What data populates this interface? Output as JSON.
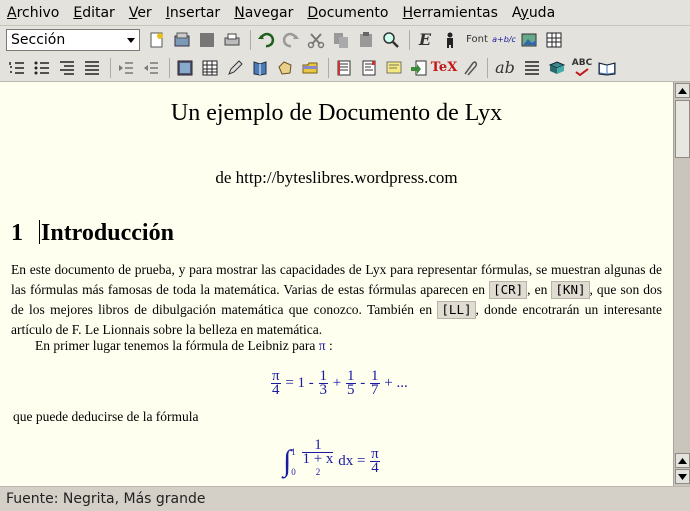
{
  "menu": [
    {
      "pre": "",
      "u": "A",
      "post": "rchivo"
    },
    {
      "pre": "",
      "u": "E",
      "post": "ditar"
    },
    {
      "pre": "",
      "u": "V",
      "post": "er"
    },
    {
      "pre": "",
      "u": "I",
      "post": "nsertar"
    },
    {
      "pre": "",
      "u": "N",
      "post": "avegar"
    },
    {
      "pre": "",
      "u": "D",
      "post": "ocumento"
    },
    {
      "pre": "",
      "u": "H",
      "post": "erramientas"
    },
    {
      "pre": "A",
      "u": "y",
      "post": "uda"
    }
  ],
  "toolbar": {
    "style_select": "Sección",
    "font_label": "Font",
    "math_label": "a+b/c",
    "tex_label": "TeX",
    "ab_label": "ab",
    "abc_label": "ABC"
  },
  "document": {
    "title": "Un ejemplo de Documento de Lyx",
    "author": "de http://byteslibres.wordpress.com",
    "section_number": "1",
    "section_title": "Introducción",
    "para1_a": "En este documento de prueba, y para mostrar las capacidades de Lyx para representar fórmulas, se muestran algunas de las fórmulas más famosas de toda la matemática. Varias de estas fórmulas aparecen en ",
    "cite_cr": "[CR]",
    "para1_b": ", en ",
    "cite_kn": "[KN]",
    "para1_c": ", que son dos de los mejores libros de dibulgación matemática que conozco. También en ",
    "cite_ll": "[LL]",
    "para1_d": ", donde encotrarán un interesante artículo de F. Le Lionnais sobre la belleza en matemática.",
    "para2": "En primer lugar tenemos la fórmula de Leibniz para ",
    "pi": "π",
    "colon": ":",
    "para3": "que puede deducirse de la fórmula",
    "f1_lhs_num": "π",
    "f1_lhs_den": "4",
    "f1_eq": "= 1 -",
    "f1_t1_num": "1",
    "f1_t1_den": "3",
    "f1_plus1": "+",
    "f1_t2_num": "1",
    "f1_t2_den": "5",
    "f1_minus": "-",
    "f1_t3_num": "1",
    "f1_t3_den": "7",
    "f1_tail": "+ ...",
    "f2_upper": "1",
    "f2_lower": "0",
    "f2_num": "1",
    "f2_den": "1 + x",
    "f2_exp": "2",
    "f2_dx": "dx =",
    "f2_rhs_num": "π",
    "f2_rhs_den": "4"
  },
  "status": "Fuente: Negrita, Más grande",
  "colors": {
    "math": "#1a1aa0",
    "document_bg": "#fffff0",
    "chrome_bg": "#d4d0c8"
  }
}
